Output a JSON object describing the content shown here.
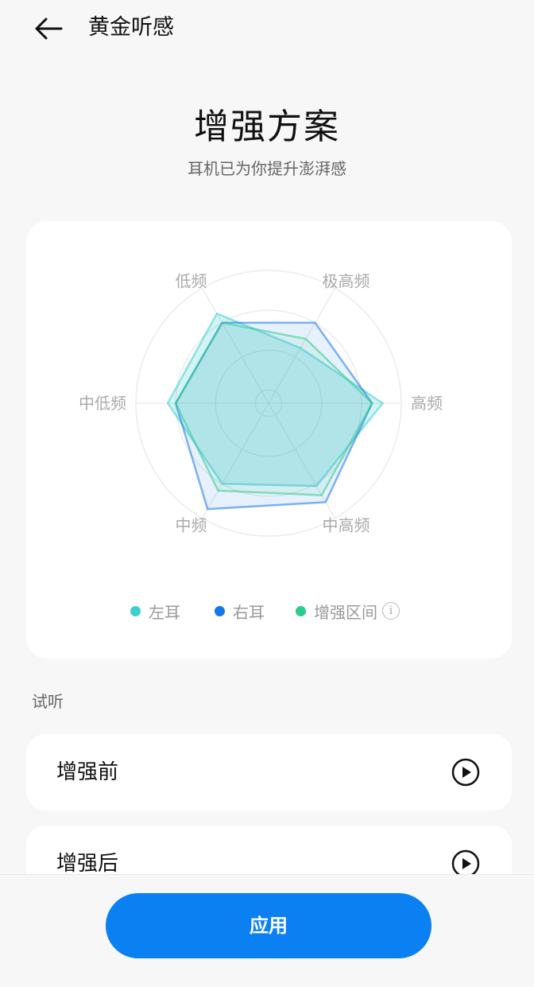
{
  "header": {
    "title": "黄金听感",
    "back_icon": "arrow-left-icon"
  },
  "hero": {
    "title": "增强方案",
    "subtitle": "耳机已为你提升澎湃感"
  },
  "chart_data": {
    "type": "radar",
    "axes": [
      "极高频",
      "高频",
      "中高频",
      "中频",
      "中低频",
      "低频"
    ],
    "range": [
      0,
      5
    ],
    "grid": true,
    "series": [
      {
        "name": "左耳",
        "color": "#3ccfcf",
        "values": [
          2.4,
          4.3,
          3.6,
          3.5,
          3.8,
          3.9
        ]
      },
      {
        "name": "右耳",
        "color": "#1677e8",
        "values": [
          3.5,
          3.9,
          4.3,
          4.6,
          3.5,
          3.5
        ]
      },
      {
        "name": "增强区间",
        "color": "#2ecc8a",
        "values": [
          2.8,
          3.9,
          4.0,
          3.8,
          3.5,
          3.5
        ]
      }
    ]
  },
  "legend": {
    "items": [
      {
        "label": "左耳",
        "color": "#3ccfcf"
      },
      {
        "label": "右耳",
        "color": "#1677e8"
      },
      {
        "label": "增强区间",
        "color": "#2ecc8a"
      }
    ],
    "info_icon": "info-icon"
  },
  "listen": {
    "section_label": "试听",
    "items": [
      {
        "label": "增强前",
        "icon": "play-icon"
      },
      {
        "label": "增强后",
        "icon": "play-icon"
      }
    ]
  },
  "actions": {
    "apply_label": "应用"
  }
}
